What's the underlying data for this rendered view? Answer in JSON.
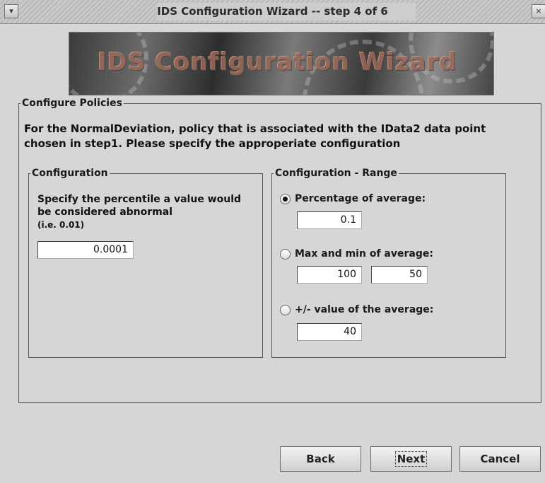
{
  "window": {
    "title": "IDS Configuration Wizard -- step 4 of 6",
    "menu_icon": "chevron-down-icon",
    "close_icon": "close-icon"
  },
  "banner": {
    "logo_text": "IDS Configuration Wizard"
  },
  "policies": {
    "legend": "Configure Policies",
    "description": "For the NormalDeviation, policy that is associated with the IData2 data point chosen in step1. Please specify the approperiate configuration"
  },
  "configuration": {
    "legend": "Configuration",
    "instruction": "Specify the percentile a value would be considered abnormal",
    "example": "(i.e. 0.01)",
    "percentile_value": "0.0001"
  },
  "range": {
    "legend": "Configuration - Range",
    "options": [
      {
        "label": "Percentage of average:",
        "selected": true,
        "values": [
          "0.1"
        ]
      },
      {
        "label": "Max and min of average:",
        "selected": false,
        "values": [
          "100",
          "50"
        ]
      },
      {
        "label": "+/- value of the average:",
        "selected": false,
        "values": [
          "40"
        ]
      }
    ]
  },
  "buttons": {
    "back": "Back",
    "next": "Next",
    "cancel": "Cancel"
  }
}
